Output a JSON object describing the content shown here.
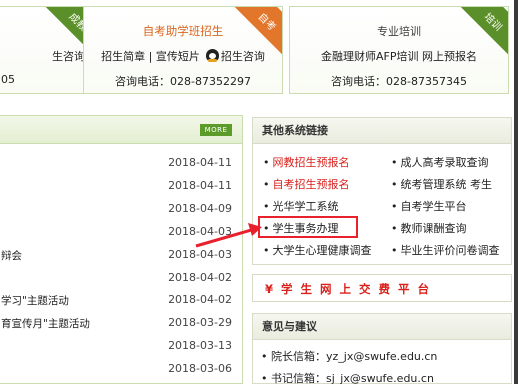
{
  "cards": {
    "left": {
      "corner": "成教",
      "links": "生咨询",
      "phone": "05"
    },
    "mid": {
      "title": "自考助学班招生",
      "corner": "自考",
      "links": "招生简章 | 宣传短片",
      "qq_label": "招生咨询",
      "phone": "咨询电话：028-87352297"
    },
    "right": {
      "title": "专业培训",
      "corner": "培训",
      "links": "金融理财师AFP培训   网上预报名",
      "phone": "咨询电话：028-87357345"
    }
  },
  "news": {
    "more": "MORE",
    "rows": [
      {
        "title": "",
        "date": "2018-04-11"
      },
      {
        "title": "",
        "date": "2018-04-11"
      },
      {
        "title": "",
        "date": "2018-04-09"
      },
      {
        "title": "",
        "date": "2018-04-03"
      },
      {
        "title": "辩会",
        "date": "2018-04-03"
      },
      {
        "title": "",
        "date": "2018-04-02"
      },
      {
        "title": "学习\"主题活动",
        "date": "2018-04-02"
      },
      {
        "title": "育宣传月\"主题活动",
        "date": "2018-03-29"
      },
      {
        "title": "",
        "date": "2018-03-13"
      },
      {
        "title": "",
        "date": "2018-03-06"
      }
    ]
  },
  "systems": {
    "title": "其他系统链接",
    "left": [
      {
        "label": "网教招生预报名",
        "red": true
      },
      {
        "label": "自考招生预报名",
        "red": true
      },
      {
        "label": "光华学工系统",
        "red": false
      },
      {
        "label": "学生事务办理",
        "red": false
      },
      {
        "label": "大学生心理健康调查",
        "red": false
      }
    ],
    "right": [
      {
        "label": "成人高考录取查询"
      },
      {
        "label": "统考管理系统   考生"
      },
      {
        "label": "自考学生平台"
      },
      {
        "label": "教师课酬查询"
      },
      {
        "label": "毕业生评价问卷调查"
      }
    ]
  },
  "payment": {
    "label": "¥  学 生 网 上 交 费 平 台"
  },
  "advice": {
    "title": "意见与建议",
    "rows": [
      "• 院长信箱：yz_jx@swufe.edu.cn",
      "• 书记信箱：sj_jx@swufe.edu.cn"
    ]
  },
  "colors": {
    "accent_red": "#e8212c",
    "green": "#5b8f29",
    "orange": "#e2762a"
  }
}
